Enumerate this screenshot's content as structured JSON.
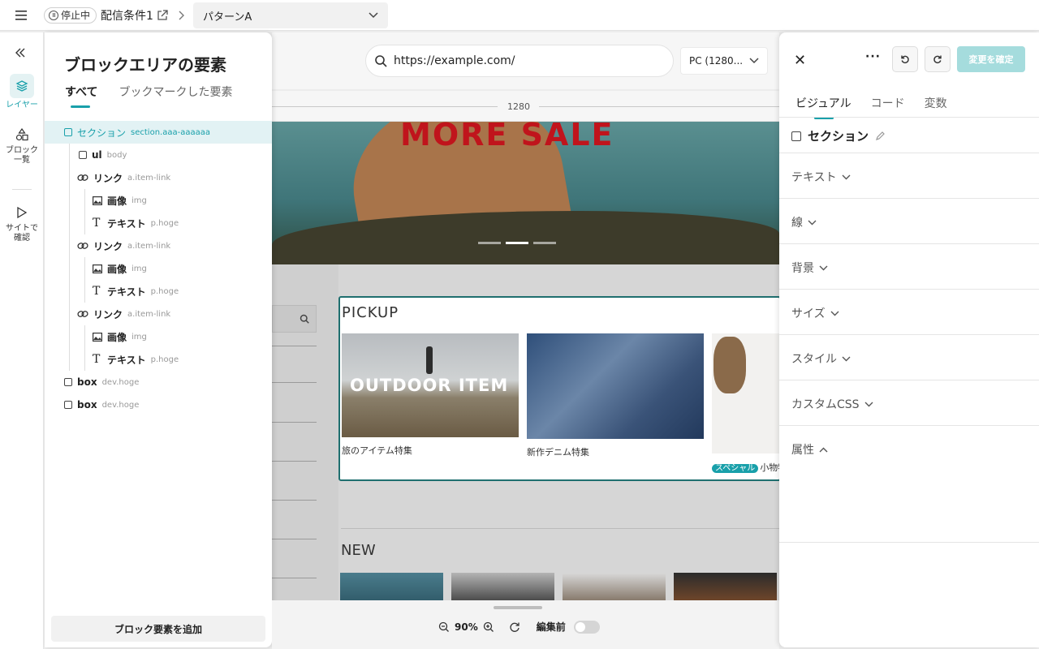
{
  "topbar": {
    "status": "停止中",
    "condition_title": "配信条件1",
    "pattern": "パターンA"
  },
  "rail": {
    "layers_label": "レイヤー",
    "blocks_label_1": "ブロック",
    "blocks_label_2": "一覧",
    "site_label_1": "サイトで",
    "site_label_2": "確認"
  },
  "layers_panel": {
    "title": "ブロックエリアの要素",
    "tabs": [
      "すべて",
      "ブックマークした要素"
    ],
    "add_button": "ブロック要素を追加",
    "tree": [
      {
        "name": "セクション",
        "sub": "section.aaa-aaaaaa"
      },
      {
        "name": "ul",
        "sub": "body"
      },
      {
        "name": "リンク",
        "sub": "a.item-link"
      },
      {
        "name": "画像",
        "sub": "img"
      },
      {
        "name": "テキスト",
        "sub": "p.hoge"
      },
      {
        "name": "リンク",
        "sub": "a.item-link"
      },
      {
        "name": "画像",
        "sub": "img"
      },
      {
        "name": "テキスト",
        "sub": "p.hoge"
      },
      {
        "name": "リンク",
        "sub": "a.item-link"
      },
      {
        "name": "画像",
        "sub": "img"
      },
      {
        "name": "テキスト",
        "sub": "p.hoge"
      },
      {
        "name": "box",
        "sub": "dev.hoge"
      },
      {
        "name": "box",
        "sub": "dev.hoge"
      }
    ]
  },
  "canvas": {
    "url": "https://example.com/",
    "device": "PC (1280...",
    "ruler_width": "1280",
    "hero_title": "MORE SALE",
    "pickup_title": "PICKUP",
    "cards": [
      {
        "overlay": "OUTDOOR ITEM",
        "caption": "旅のアイテム特集"
      },
      {
        "overlay": "",
        "caption": "新作デニム特集"
      },
      {
        "badge": "スペシャル",
        "caption": "小物特"
      }
    ],
    "new_title": "NEW"
  },
  "bottombar": {
    "zoom": "90%",
    "edit_label": "編集前"
  },
  "right_panel": {
    "confirm_label": "変更を確定",
    "tabs": [
      "ビジュアル",
      "コード",
      "変数"
    ],
    "section_name": "セクション",
    "props": [
      "テキスト",
      "線",
      "背景",
      "サイズ",
      "スタイル",
      "カスタムCSS",
      "属性"
    ]
  },
  "colors": {
    "accent": "#19a0aa",
    "hero_title": "#c0141c"
  }
}
